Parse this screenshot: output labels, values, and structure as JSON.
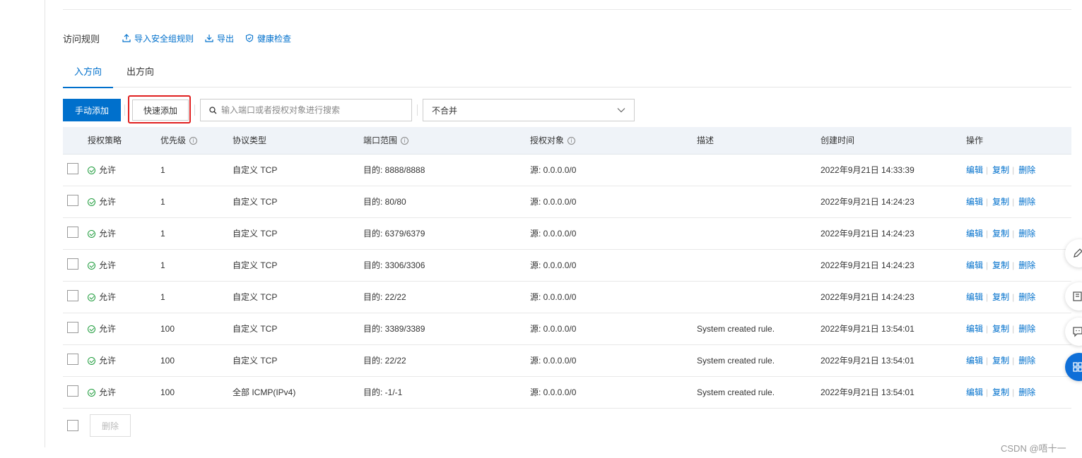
{
  "header": {
    "title": "访问规则",
    "links": [
      "导入安全组规则",
      "导出",
      "健康检查"
    ]
  },
  "tabs": [
    "入方向",
    "出方向"
  ],
  "toolbar": {
    "manual_add": "手动添加",
    "quick_add": "快速添加",
    "search_placeholder": "输入端口或者授权对象进行搜索",
    "merge_select": "不合并"
  },
  "columns": [
    "授权策略",
    "优先级",
    "协议类型",
    "端口范围",
    "授权对象",
    "描述",
    "创建时间",
    "操作"
  ],
  "rows": [
    {
      "policy": "允许",
      "priority": "1",
      "protocol": "自定义 TCP",
      "port": "目的: 8888/8888",
      "source": "源: 0.0.0.0/0",
      "desc": "",
      "created": "2022年9月21日 14:33:39"
    },
    {
      "policy": "允许",
      "priority": "1",
      "protocol": "自定义 TCP",
      "port": "目的: 80/80",
      "source": "源: 0.0.0.0/0",
      "desc": "",
      "created": "2022年9月21日 14:24:23"
    },
    {
      "policy": "允许",
      "priority": "1",
      "protocol": "自定义 TCP",
      "port": "目的: 6379/6379",
      "source": "源: 0.0.0.0/0",
      "desc": "",
      "created": "2022年9月21日 14:24:23"
    },
    {
      "policy": "允许",
      "priority": "1",
      "protocol": "自定义 TCP",
      "port": "目的: 3306/3306",
      "source": "源: 0.0.0.0/0",
      "desc": "",
      "created": "2022年9月21日 14:24:23"
    },
    {
      "policy": "允许",
      "priority": "1",
      "protocol": "自定义 TCP",
      "port": "目的: 22/22",
      "source": "源: 0.0.0.0/0",
      "desc": "",
      "created": "2022年9月21日 14:24:23"
    },
    {
      "policy": "允许",
      "priority": "100",
      "protocol": "自定义 TCP",
      "port": "目的: 3389/3389",
      "source": "源: 0.0.0.0/0",
      "desc": "System created rule.",
      "created": "2022年9月21日 13:54:01"
    },
    {
      "policy": "允许",
      "priority": "100",
      "protocol": "自定义 TCP",
      "port": "目的: 22/22",
      "source": "源: 0.0.0.0/0",
      "desc": "System created rule.",
      "created": "2022年9月21日 13:54:01"
    },
    {
      "policy": "允许",
      "priority": "100",
      "protocol": "全部 ICMP(IPv4)",
      "port": "目的: -1/-1",
      "source": "源: 0.0.0.0/0",
      "desc": "System created rule.",
      "created": "2022年9月21日 13:54:01"
    }
  ],
  "row_actions": [
    "编辑",
    "复制",
    "删除"
  ],
  "footer": {
    "delete": "删除"
  },
  "watermark": "CSDN @唔十一"
}
